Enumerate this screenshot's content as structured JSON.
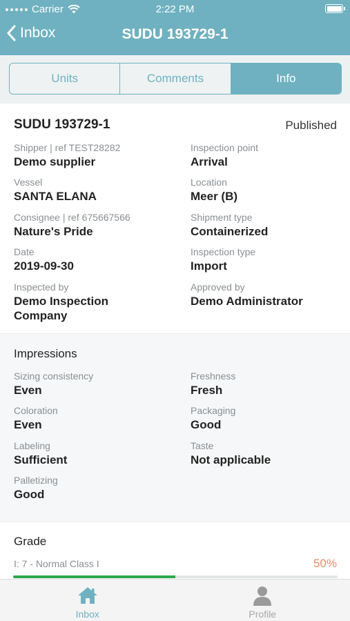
{
  "status_bar": {
    "carrier": "Carrier",
    "time": "2:22 PM"
  },
  "nav": {
    "back_label": "Inbox",
    "title": "SUDU 193729-1"
  },
  "segments": [
    {
      "label": "Units",
      "active": false
    },
    {
      "label": "Comments",
      "active": false
    },
    {
      "label": "Info",
      "active": true
    }
  ],
  "details": {
    "title": "SUDU 193729-1",
    "status": "Published",
    "fields": [
      {
        "label": "Shipper | ref TEST28282",
        "value": "Demo supplier"
      },
      {
        "label": "Inspection point",
        "value": "Arrival"
      },
      {
        "label": "Vessel",
        "value": "SANTA ELANA"
      },
      {
        "label": "Location",
        "value": "Meer (B)"
      },
      {
        "label": "Consignee | ref 675667566",
        "value": "Nature's Pride"
      },
      {
        "label": "Shipment type",
        "value": "Containerized"
      },
      {
        "label": "Date",
        "value": "2019-09-30"
      },
      {
        "label": "Inspection type",
        "value": "Import"
      },
      {
        "label": "Inspected by",
        "value": "Demo Inspection Company"
      },
      {
        "label": "Approved by",
        "value": "Demo Administrator"
      }
    ]
  },
  "impressions": {
    "heading": "Impressions",
    "fields": [
      {
        "label": "Sizing consistency",
        "value": "Even"
      },
      {
        "label": "Freshness",
        "value": "Fresh"
      },
      {
        "label": "Coloration",
        "value": "Even"
      },
      {
        "label": "Packaging",
        "value": "Good"
      },
      {
        "label": "Labeling",
        "value": "Sufficient"
      },
      {
        "label": "Taste",
        "value": "Not applicable"
      },
      {
        "label": "Palletizing",
        "value": "Good"
      }
    ]
  },
  "grade": {
    "heading": "Grade",
    "line": "I: 7 - Normal Class I",
    "percent_text": "50%",
    "progress_fraction": 0.5,
    "bar_color": "#2fa84f"
  },
  "tabbar": [
    {
      "label": "Inbox",
      "icon": "home-icon",
      "active": true
    },
    {
      "label": "Profile",
      "icon": "person-icon",
      "active": false
    }
  ],
  "colors": {
    "accent": "#6fb1c0",
    "percent": "#ef8a66"
  }
}
